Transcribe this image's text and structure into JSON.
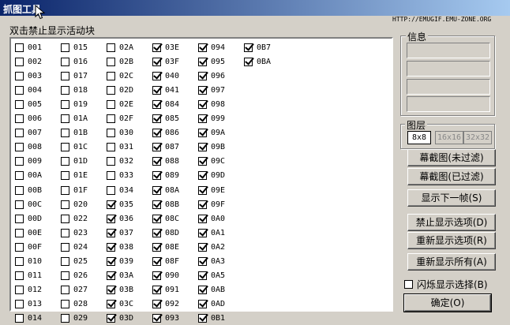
{
  "window": {
    "title": "抓图工具"
  },
  "url_label": "HTTP://EMUGIF.EMU-ZONE.ORG",
  "hint": "双击禁止显示活动块",
  "columns": [
    [
      {
        "label": "001",
        "checked": false
      },
      {
        "label": "002",
        "checked": false
      },
      {
        "label": "003",
        "checked": false
      },
      {
        "label": "004",
        "checked": false
      },
      {
        "label": "005",
        "checked": false
      },
      {
        "label": "006",
        "checked": false
      },
      {
        "label": "007",
        "checked": false
      },
      {
        "label": "008",
        "checked": false
      },
      {
        "label": "009",
        "checked": false
      },
      {
        "label": "00A",
        "checked": false
      },
      {
        "label": "00B",
        "checked": false
      },
      {
        "label": "00C",
        "checked": false
      },
      {
        "label": "00D",
        "checked": false
      },
      {
        "label": "00E",
        "checked": false
      },
      {
        "label": "00F",
        "checked": false
      },
      {
        "label": "010",
        "checked": false
      },
      {
        "label": "011",
        "checked": false
      },
      {
        "label": "012",
        "checked": false
      },
      {
        "label": "013",
        "checked": false
      },
      {
        "label": "014",
        "checked": false
      }
    ],
    [
      {
        "label": "015",
        "checked": false
      },
      {
        "label": "016",
        "checked": false
      },
      {
        "label": "017",
        "checked": false
      },
      {
        "label": "018",
        "checked": false
      },
      {
        "label": "019",
        "checked": false
      },
      {
        "label": "01A",
        "checked": false
      },
      {
        "label": "01B",
        "checked": false
      },
      {
        "label": "01C",
        "checked": false
      },
      {
        "label": "01D",
        "checked": false
      },
      {
        "label": "01E",
        "checked": false
      },
      {
        "label": "01F",
        "checked": false
      },
      {
        "label": "020",
        "checked": false
      },
      {
        "label": "022",
        "checked": false
      },
      {
        "label": "023",
        "checked": false
      },
      {
        "label": "024",
        "checked": false
      },
      {
        "label": "025",
        "checked": false
      },
      {
        "label": "026",
        "checked": false
      },
      {
        "label": "027",
        "checked": false
      },
      {
        "label": "028",
        "checked": false
      },
      {
        "label": "029",
        "checked": false
      }
    ],
    [
      {
        "label": "02A",
        "checked": false
      },
      {
        "label": "02B",
        "checked": false
      },
      {
        "label": "02C",
        "checked": false
      },
      {
        "label": "02D",
        "checked": false
      },
      {
        "label": "02E",
        "checked": false
      },
      {
        "label": "02F",
        "checked": false
      },
      {
        "label": "030",
        "checked": false
      },
      {
        "label": "031",
        "checked": false
      },
      {
        "label": "032",
        "checked": false
      },
      {
        "label": "033",
        "checked": false
      },
      {
        "label": "034",
        "checked": false
      },
      {
        "label": "035",
        "checked": true
      },
      {
        "label": "036",
        "checked": true
      },
      {
        "label": "037",
        "checked": true
      },
      {
        "label": "038",
        "checked": true
      },
      {
        "label": "039",
        "checked": true
      },
      {
        "label": "03A",
        "checked": true
      },
      {
        "label": "03B",
        "checked": true
      },
      {
        "label": "03C",
        "checked": true
      },
      {
        "label": "03D",
        "checked": true
      }
    ],
    [
      {
        "label": "03E",
        "checked": true
      },
      {
        "label": "03F",
        "checked": true
      },
      {
        "label": "040",
        "checked": true
      },
      {
        "label": "041",
        "checked": true
      },
      {
        "label": "084",
        "checked": true
      },
      {
        "label": "085",
        "checked": true
      },
      {
        "label": "086",
        "checked": true
      },
      {
        "label": "087",
        "checked": true
      },
      {
        "label": "088",
        "checked": true
      },
      {
        "label": "089",
        "checked": true
      },
      {
        "label": "08A",
        "checked": true
      },
      {
        "label": "08B",
        "checked": true
      },
      {
        "label": "08C",
        "checked": true
      },
      {
        "label": "08D",
        "checked": true
      },
      {
        "label": "08E",
        "checked": true
      },
      {
        "label": "08F",
        "checked": true
      },
      {
        "label": "090",
        "checked": true
      },
      {
        "label": "091",
        "checked": true
      },
      {
        "label": "092",
        "checked": true
      },
      {
        "label": "093",
        "checked": true
      }
    ],
    [
      {
        "label": "094",
        "checked": true
      },
      {
        "label": "095",
        "checked": true
      },
      {
        "label": "096",
        "checked": true
      },
      {
        "label": "097",
        "checked": true
      },
      {
        "label": "098",
        "checked": true
      },
      {
        "label": "099",
        "checked": true
      },
      {
        "label": "09A",
        "checked": true
      },
      {
        "label": "09B",
        "checked": true
      },
      {
        "label": "09C",
        "checked": true
      },
      {
        "label": "09D",
        "checked": true
      },
      {
        "label": "09E",
        "checked": true
      },
      {
        "label": "09F",
        "checked": true
      },
      {
        "label": "0A0",
        "checked": true
      },
      {
        "label": "0A1",
        "checked": true
      },
      {
        "label": "0A2",
        "checked": true
      },
      {
        "label": "0A3",
        "checked": true
      },
      {
        "label": "0A5",
        "checked": true
      },
      {
        "label": "0AB",
        "checked": true
      },
      {
        "label": "0AD",
        "checked": true
      },
      {
        "label": "0B1",
        "checked": true
      }
    ],
    [
      {
        "label": "0B7",
        "checked": true
      },
      {
        "label": "0BA",
        "checked": true
      }
    ]
  ],
  "info": {
    "legend": "信息"
  },
  "layers": {
    "legend": "图层",
    "options": [
      {
        "label": "8x8",
        "state": "active"
      },
      {
        "label": "16x16",
        "state": "disabled"
      },
      {
        "label": "32x32",
        "state": "disabled"
      }
    ]
  },
  "buttons": {
    "screenshot_unfiltered": "幕截图(未过滤)",
    "screenshot_filtered": "幕截图(已过滤)",
    "next_frame": "显示下一帧(S)",
    "hide_selected": "禁止显示选项(D)",
    "reshow_selected": "重新显示选项(R)",
    "reshow_all": "重新显示所有(A)",
    "ok": "确定(O)"
  },
  "flash_select": {
    "label": "闪烁显示选择(B)",
    "checked": false
  }
}
